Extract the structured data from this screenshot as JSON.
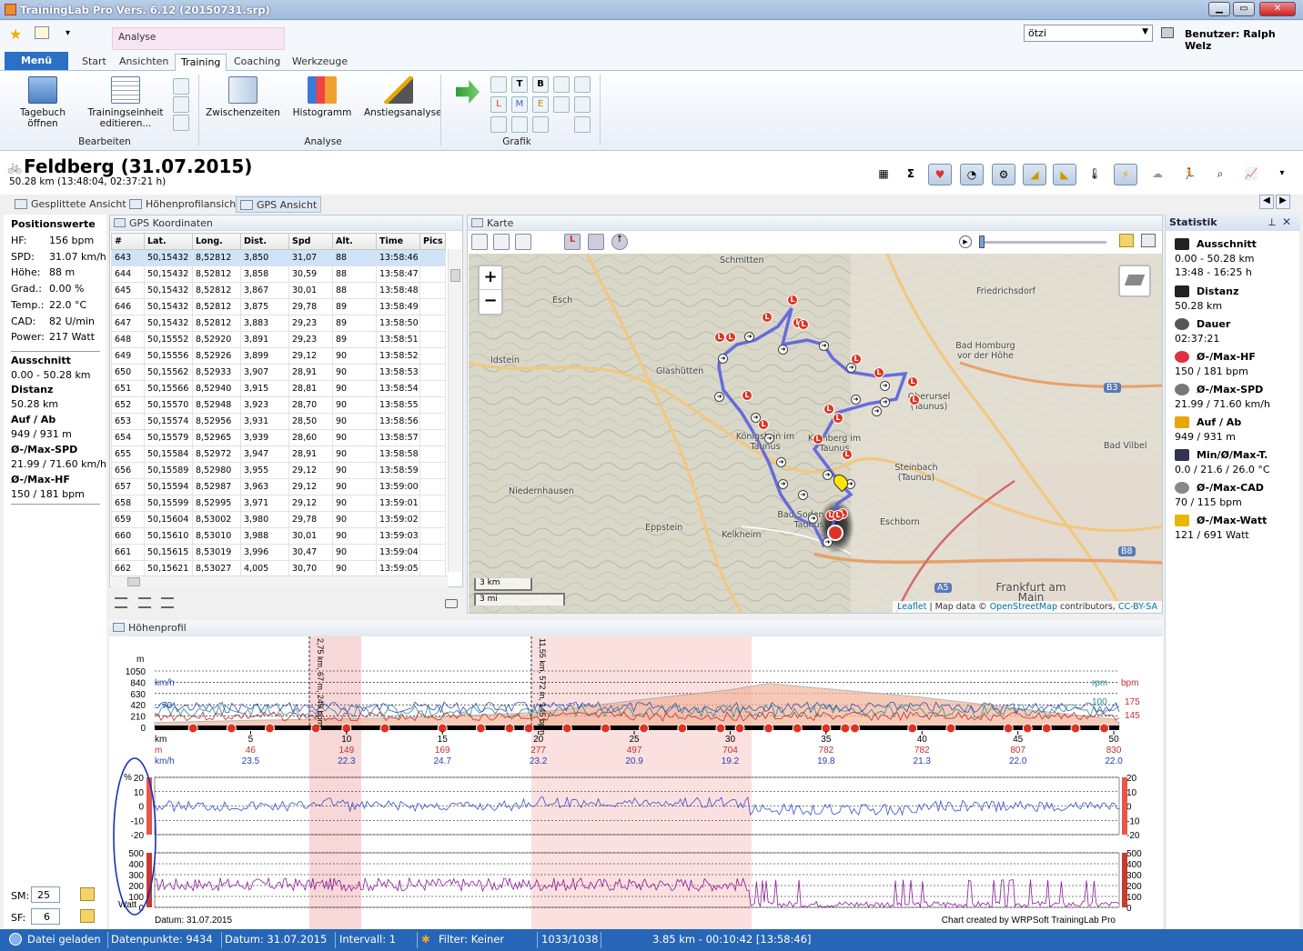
{
  "window": {
    "title": "TrainingLab Pro Vers. 6.12 (20150731.srp)",
    "min": "▁",
    "max": "▭",
    "close": "✕"
  },
  "qat": {
    "user_select": "ötzi",
    "user_label": "Benutzer: Ralph Welz",
    "star": "★",
    "drop": "▾"
  },
  "context_group": "Analyse",
  "tabs": {
    "menu": "Menü",
    "items": [
      "Start",
      "Ansichten",
      "Training",
      "Coaching",
      "Werkzeuge"
    ]
  },
  "ribbon": {
    "tagebuch": "Tagebuch öffnen",
    "trainingseinheit": "Trainingseinheit editieren...",
    "bearbeiten": "Bearbeiten",
    "zwischenzeiten": "Zwischenzeiten",
    "histogramm": "Histogramm",
    "anstieg": "Anstiegsanalyse",
    "analyse": "Analyse",
    "grafik": "Grafik"
  },
  "header": {
    "title": "Feldberg (31.07.2015)",
    "subtitle": "50.28 km (13:48:04, 02:37:21 h)",
    "sigma": "Σ"
  },
  "viewtabs": [
    "Gesplittete Ansicht",
    "Höhenprofilansicht",
    "GPS Ansicht"
  ],
  "left": {
    "title": "Positionswerte",
    "rows": [
      [
        "HF:",
        "156 bpm"
      ],
      [
        "SPD:",
        "31.07 km/h"
      ],
      [
        "Höhe:",
        "88 m"
      ],
      [
        "Grad.:",
        "0.00 %"
      ],
      [
        "Temp.:",
        "22.0 °C"
      ],
      [
        "CAD:",
        "82 U/min"
      ],
      [
        "Power:",
        "217 Watt"
      ]
    ],
    "ausschnitt_lbl": "Ausschnitt",
    "ausschnitt": "0.00 - 50.28 km",
    "distanz_lbl": "Distanz",
    "distanz": "50.28 km",
    "aufab_lbl": "Auf / Ab",
    "aufab": "949 / 931 m",
    "spd_lbl": "Ø-/Max-SPD",
    "spd": "21.99 / 71.60 km/h",
    "hf_lbl": "Ø-/Max-HF",
    "hf": "150 / 181 bpm",
    "sm_lbl": "SM:",
    "sm": "25",
    "sf_lbl": "SF:",
    "sf": "6"
  },
  "gps": {
    "title": "GPS Koordinaten",
    "columns": [
      "#",
      "Lat.",
      "Long.",
      "Dist.",
      "Spd",
      "Alt.",
      "Time",
      "Pics"
    ],
    "rows": [
      [
        "643",
        "50,15432",
        "8,52812",
        "3,850",
        "31,07",
        "88",
        "13:58:46"
      ],
      [
        "644",
        "50,15432",
        "8,52812",
        "3,858",
        "30,59",
        "88",
        "13:58:47"
      ],
      [
        "645",
        "50,15432",
        "8,52812",
        "3,867",
        "30,01",
        "88",
        "13:58:48"
      ],
      [
        "646",
        "50,15432",
        "8,52812",
        "3,875",
        "29,78",
        "89",
        "13:58:49"
      ],
      [
        "647",
        "50,15432",
        "8,52812",
        "3,883",
        "29,23",
        "89",
        "13:58:50"
      ],
      [
        "648",
        "50,15552",
        "8,52920",
        "3,891",
        "29,23",
        "89",
        "13:58:51"
      ],
      [
        "649",
        "50,15556",
        "8,52926",
        "3,899",
        "29,12",
        "90",
        "13:58:52"
      ],
      [
        "650",
        "50,15562",
        "8,52933",
        "3,907",
        "28,91",
        "90",
        "13:58:53"
      ],
      [
        "651",
        "50,15566",
        "8,52940",
        "3,915",
        "28,81",
        "90",
        "13:58:54"
      ],
      [
        "652",
        "50,15570",
        "8,52948",
        "3,923",
        "28,70",
        "90",
        "13:58:55"
      ],
      [
        "653",
        "50,15574",
        "8,52956",
        "3,931",
        "28,50",
        "90",
        "13:58:56"
      ],
      [
        "654",
        "50,15579",
        "8,52965",
        "3,939",
        "28,60",
        "90",
        "13:58:57"
      ],
      [
        "655",
        "50,15584",
        "8,52972",
        "3,947",
        "28,91",
        "90",
        "13:58:58"
      ],
      [
        "656",
        "50,15589",
        "8,52980",
        "3,955",
        "29,12",
        "90",
        "13:58:59"
      ],
      [
        "657",
        "50,15594",
        "8,52987",
        "3,963",
        "29,12",
        "90",
        "13:59:00"
      ],
      [
        "658",
        "50,15599",
        "8,52995",
        "3,971",
        "29,12",
        "90",
        "13:59:01"
      ],
      [
        "659",
        "50,15604",
        "8,53002",
        "3,980",
        "29,78",
        "90",
        "13:59:02"
      ],
      [
        "660",
        "50,15610",
        "8,53010",
        "3,988",
        "30,01",
        "90",
        "13:59:03"
      ],
      [
        "661",
        "50,15615",
        "8,53019",
        "3,996",
        "30,47",
        "90",
        "13:59:04"
      ],
      [
        "662",
        "50,15621",
        "8,53027",
        "4,005",
        "30,70",
        "90",
        "13:59:05"
      ]
    ]
  },
  "map": {
    "title": "Karte",
    "zoom_in": "+",
    "zoom_out": "−",
    "scale_km": "3 km",
    "scale_mi": "3 mi",
    "leaflet": "Leaflet",
    "attrib_mid": " | Map data © ",
    "osm": "OpenStreetMap",
    "attrib_end": " contributors, ",
    "license": "CC-BY-SA",
    "labels": [
      "Schmitten",
      "Esch",
      "Friedrichsdorf",
      "Idstein",
      "Glashütten",
      "Bad Homburg vor der Höhe",
      "Oberursel (Taunus)",
      "Königstein im Taunus",
      "Kronberg im Taunus",
      "Bad Vilbel",
      "Niedernhausen",
      "Steinbach (Taunus)",
      "Eppstein",
      "Bad Soden am Taunus",
      "Eschborn",
      "Kelkheim",
      "Frankfurt am Main",
      "B3",
      "B8",
      "A5"
    ],
    "marker_letter": "L"
  },
  "stats": {
    "title": "Statistik",
    "items": [
      {
        "label": "Ausschnitt",
        "value": "0.00 - 50.28 km",
        "value2": "13:48 - 16:25 h",
        "icon": "ruler-icon"
      },
      {
        "label": "Distanz",
        "value": "50.28 km",
        "icon": "flag-icon"
      },
      {
        "label": "Dauer",
        "value": "02:37:21",
        "icon": "stopwatch-icon"
      },
      {
        "label": "Ø-/Max-HF",
        "value": "150 / 181 bpm",
        "icon": "heart-icon"
      },
      {
        "label": "Ø-/Max-SPD",
        "value": "21.99 / 71.60 km/h",
        "icon": "speedometer-icon"
      },
      {
        "label": "Auf / Ab",
        "value": "949 / 931 m",
        "icon": "mountain-icon"
      },
      {
        "label": "Min/Ø/Max-T.",
        "value": "0.0 / 21.6 / 26.0 °C",
        "icon": "thermometer-icon"
      },
      {
        "label": "Ø-/Max-CAD",
        "value": "70 / 115 bpm",
        "icon": "gear-icon"
      },
      {
        "label": "Ø-/Max-Watt",
        "value": "121 / 691 Watt",
        "icon": "lightning-icon"
      }
    ]
  },
  "profile": {
    "title": "Höhenprofil",
    "alt_ticks": [
      "1050",
      "840",
      "630",
      "420",
      "210",
      "0"
    ],
    "m": "m",
    "kmh": "km/h",
    "rpm": "rpm",
    "bpm": "bpm",
    "v70": "70",
    "v100": "100",
    "v175": "175",
    "v145": "145",
    "km_label": "km",
    "m_label": "m",
    "kmh_label": "km/h",
    "km_ticks": [
      "5",
      "10",
      "15",
      "20",
      "25",
      "30",
      "35",
      "40",
      "45",
      "50"
    ],
    "m_values": [
      "46",
      "149",
      "169",
      "277",
      "497",
      "704",
      "782",
      "782",
      "807",
      "830"
    ],
    "kmh_values": [
      "23.5",
      "22.3",
      "24.7",
      "23.2",
      "20.9",
      "19.2",
      "19.8",
      "21.3",
      "22.0",
      "22.0"
    ],
    "grad_ticks": [
      "20",
      "10",
      "0",
      "-10",
      "-20"
    ],
    "watt_ticks": [
      "500",
      "400",
      "300",
      "200",
      "100",
      "0"
    ],
    "pct": "%",
    "watt": "Watt",
    "marker1": "2,75 km, 67 m, 249 bpm",
    "marker2": "11,55 km, 572 m, 145 bpm",
    "datum": "Datum: 31.07.2015",
    "credit": "Chart created by WRPSoft TrainingLab Pro"
  },
  "status": {
    "loaded": "Datei geladen",
    "points": "Datenpunkte: 9434",
    "date": "Datum: 31.07.2015",
    "interval": "Intervall: 1",
    "filter": "Filter: Keiner",
    "count": "1033/1038",
    "pos": "3.85 km - 00:10:42 [13:58:46]"
  },
  "colors": {
    "accent": "#2766b6",
    "route": "#5a5fe0",
    "marker": "#d32"
  }
}
